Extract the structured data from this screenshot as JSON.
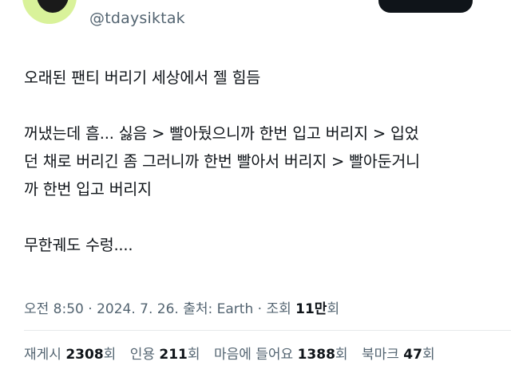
{
  "author": {
    "handle": "@tdaysiktak"
  },
  "tweet": {
    "lines": [
      "오래된 팬티 버리기 세상에서 젤 힘듬",
      "꺼냈는데 흠... 싫음 > 빨아뒀으니까 한번 입고 버리지 > 입었",
      "던 채로 버리긴 좀 그러니까 한번 빨아서 버리지 > 빨아둔거니",
      "까 한번 입고 버리지",
      "무한궤도 수렁...."
    ]
  },
  "meta": {
    "time": "오전 8:50",
    "separator": "·",
    "date": "2024. 7. 26.",
    "source_label": "출처:",
    "source": "Earth",
    "views_label": "조회",
    "views_value": "11만",
    "views_unit": "회"
  },
  "stats": {
    "retweets": {
      "label": "재게시",
      "value": "2308",
      "unit": "회"
    },
    "quotes": {
      "label": "인용",
      "value": "211",
      "unit": "회"
    },
    "likes": {
      "label": "마음에 들어요",
      "value": "1388",
      "unit": "회"
    },
    "bookmarks": {
      "label": "북마크",
      "value": "47",
      "unit": "회"
    }
  },
  "colors": {
    "text_primary": "#0f1419",
    "text_secondary": "#536471",
    "avatar_bg": "#d9f29a",
    "divider": "#e6e9eb"
  }
}
